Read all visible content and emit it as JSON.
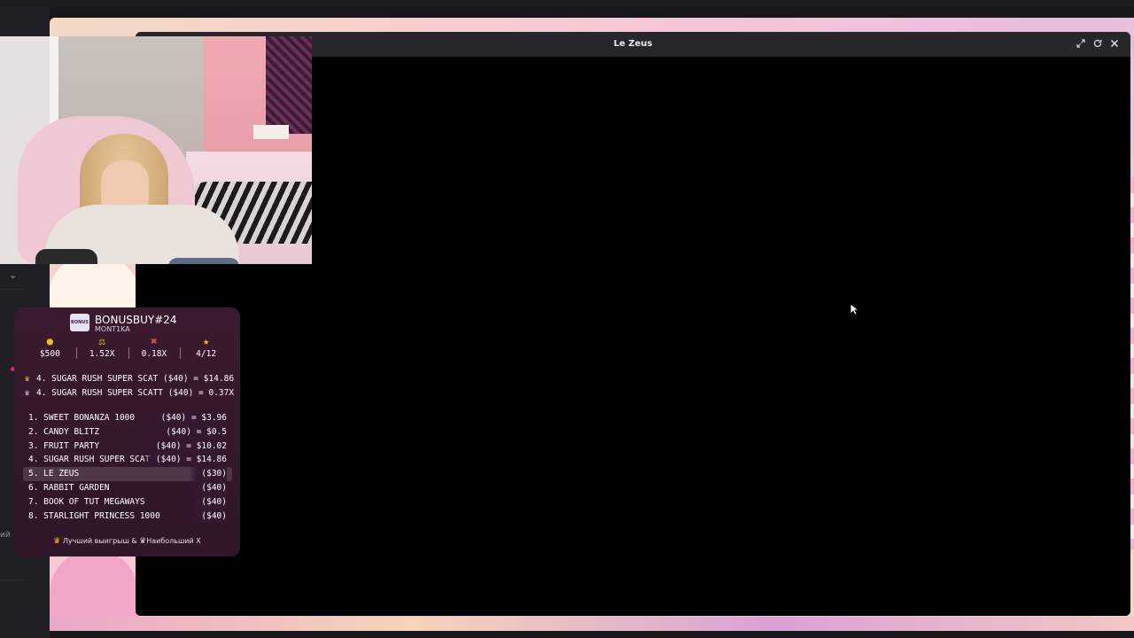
{
  "game_window": {
    "title": "Le Zeus",
    "controls": {
      "expand_icon": "expand-icon",
      "reload_icon": "reload-icon",
      "close_icon": "close-icon"
    }
  },
  "left_rail": {
    "chevron_icon": "chevron-down-icon",
    "label": "ий ⌄"
  },
  "bonus_panel": {
    "logo_text": "BONUS",
    "title": "BONUSBUY#24",
    "subtitle": "MONT1KA",
    "stats": [
      {
        "icon": "coin-icon",
        "glyph": "●",
        "color": "#f1c40f",
        "value": "$500"
      },
      {
        "icon": "scales-icon",
        "glyph": "⚖",
        "color": "#f1c40f",
        "value": "1.52X"
      },
      {
        "icon": "cross-icon",
        "glyph": "✖",
        "color": "#e74c3c",
        "value": "0.18X"
      },
      {
        "icon": "star-icon",
        "glyph": "★",
        "color": "#f5c518",
        "value": "4/12"
      }
    ],
    "best": [
      {
        "crown_color": "#f5c518",
        "text": "4. SUGAR RUSH SUPER SCAT ($40) = $14.86"
      },
      {
        "crown_color": "#d8d0e6",
        "text": "4. SUGAR RUSH SUPER SCATT ($40) = 0.37X"
      }
    ],
    "list": [
      {
        "name": "1.  SWEET BONANZA 1000",
        "amount": "($40) = $3.96"
      },
      {
        "name": "2.  CANDY BLITZ",
        "amount": "($40) = $0.5"
      },
      {
        "name": "3.  FRUIT PARTY",
        "amount": "($40) = $10.02"
      },
      {
        "name": "4.  SUGAR RUSH SUPER SCATT",
        "amount": "($40) = $14.86"
      },
      {
        "name": "5.  LE ZEUS",
        "amount": "($30)"
      },
      {
        "name": "6.  RABBIT GARDEN",
        "amount": "($40)"
      },
      {
        "name": "7.  BOOK OF TUT MEGAWAYS",
        "amount": "($40)"
      },
      {
        "name": "8.  STARLIGHT PRINCESS 1000",
        "amount": "($40)"
      }
    ],
    "current_index": 4,
    "footer": {
      "best_label": "Лучший выигрыш &",
      "biggest_label": "Наибольший X"
    }
  }
}
